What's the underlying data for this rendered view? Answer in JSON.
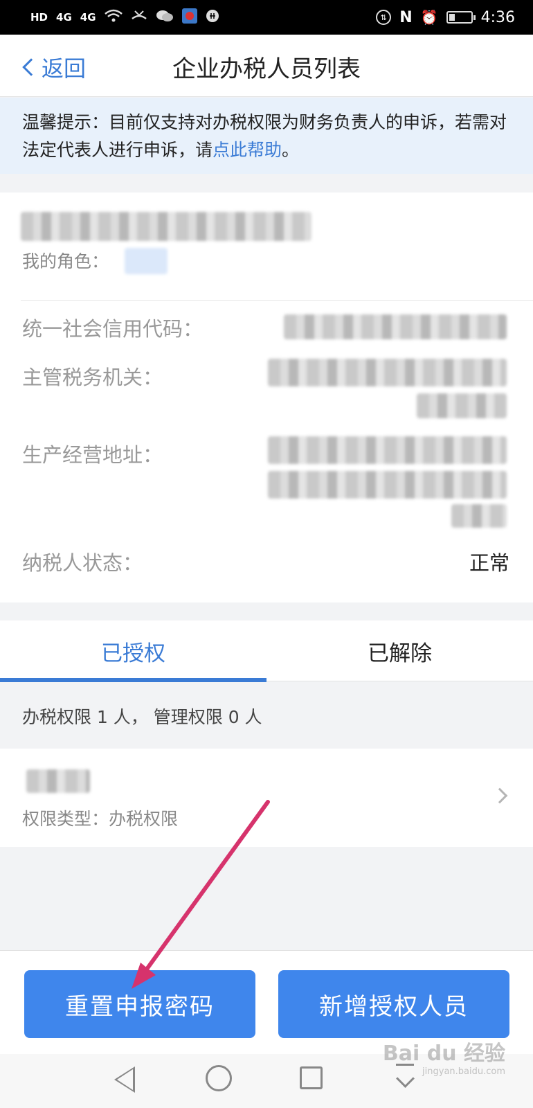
{
  "status_bar": {
    "left_indicators": [
      "HD",
      "4G",
      "4G"
    ],
    "time": "4:36"
  },
  "header": {
    "back_label": "返回",
    "title": "企业办税人员列表"
  },
  "notice": {
    "text_before": "温馨提示：目前仅支持对办税权限为财务负责人的申诉，若需对法定代表人进行申诉，请",
    "link_text": "点此帮助",
    "text_after": "。"
  },
  "company_card": {
    "role_label": "我的角色：",
    "rows": [
      {
        "label": "统一社会信用代码："
      },
      {
        "label": "主管税务机关："
      },
      {
        "label": "生产经营地址："
      },
      {
        "label": "纳税人状态：",
        "value": "正常"
      }
    ]
  },
  "tabs": [
    {
      "label": "已授权",
      "active": true
    },
    {
      "label": "已解除",
      "active": false
    }
  ],
  "summary": "办税权限 1 人， 管理权限 0 人",
  "person": {
    "type_text": "权限类型：办税权限"
  },
  "buttons": {
    "reset_label": "重置申报密码",
    "add_label": "新增授权人员"
  },
  "colors": {
    "accent": "#3a7bd5",
    "button": "#3f86ec",
    "annotation_arrow": "#d6336c"
  },
  "watermark": {
    "brand": "Bai du 经验",
    "domain": "jingyan.baidu.com"
  }
}
